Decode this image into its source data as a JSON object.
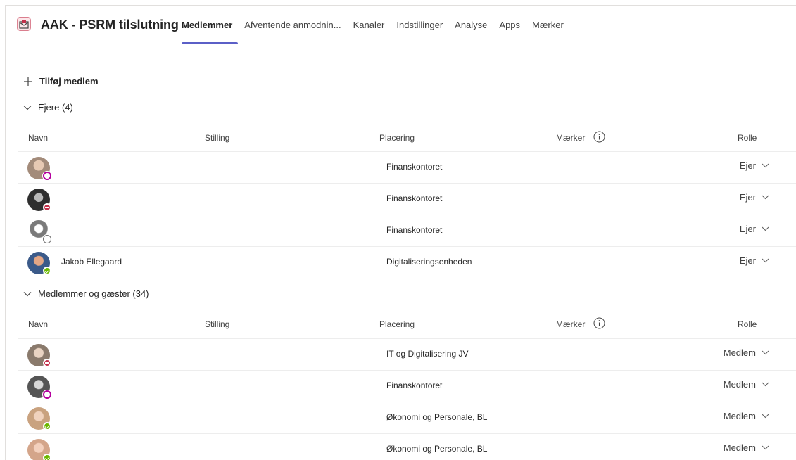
{
  "team": {
    "name": "AAK - PSRM tilslutning"
  },
  "tabs": [
    {
      "label": "Medlemmer",
      "active": true
    },
    {
      "label": "Afventende anmodnin..."
    },
    {
      "label": "Kanaler"
    },
    {
      "label": "Indstillinger"
    },
    {
      "label": "Analyse"
    },
    {
      "label": "Apps"
    },
    {
      "label": "Mærker"
    }
  ],
  "actions": {
    "add_member_label": "Tilføj medlem"
  },
  "columns": {
    "name": "Navn",
    "title": "Stilling",
    "location": "Placering",
    "tags": "Mærker",
    "role": "Rolle"
  },
  "owners": {
    "label": "Ejere (4)",
    "rows": [
      {
        "name": "",
        "location": "Finanskontoret",
        "role": "Ejer",
        "presence": "oof",
        "avatar_color": "#a38b7a"
      },
      {
        "name": "",
        "location": "Finanskontoret",
        "role": "Ejer",
        "presence": "busy",
        "avatar_color": "#3a3a3a"
      },
      {
        "name": "",
        "location": "Finanskontoret",
        "role": "Ejer",
        "presence": "offline",
        "avatar_color": "#8e8e8e"
      },
      {
        "name": "Jakob Ellegaard",
        "location": "Digitaliseringsenheden",
        "role": "Ejer",
        "presence": "available",
        "avatar_color": "#b0694a"
      }
    ]
  },
  "members": {
    "label": "Medlemmer og gæster (34)",
    "rows": [
      {
        "name": "",
        "location": "IT og Digitalisering JV",
        "role": "Medlem",
        "presence": "busy",
        "avatar_color": "#9a8a7e"
      },
      {
        "name": "",
        "location": "Finanskontoret",
        "role": "Medlem",
        "presence": "oof",
        "avatar_color": "#6d6d6d"
      },
      {
        "name": "",
        "location": "Økonomi og Personale, BL",
        "role": "Medlem",
        "presence": "available",
        "avatar_color": "#c9a27f"
      },
      {
        "name": "",
        "location": "Økonomi og Personale, BL",
        "role": "Medlem",
        "presence": "available",
        "avatar_color": "#d4a58a"
      }
    ]
  },
  "colors": {
    "accent": "#5b5fc7",
    "available": "#6bb700",
    "busy": "#c4314b",
    "away_oof": "#b4009e"
  }
}
